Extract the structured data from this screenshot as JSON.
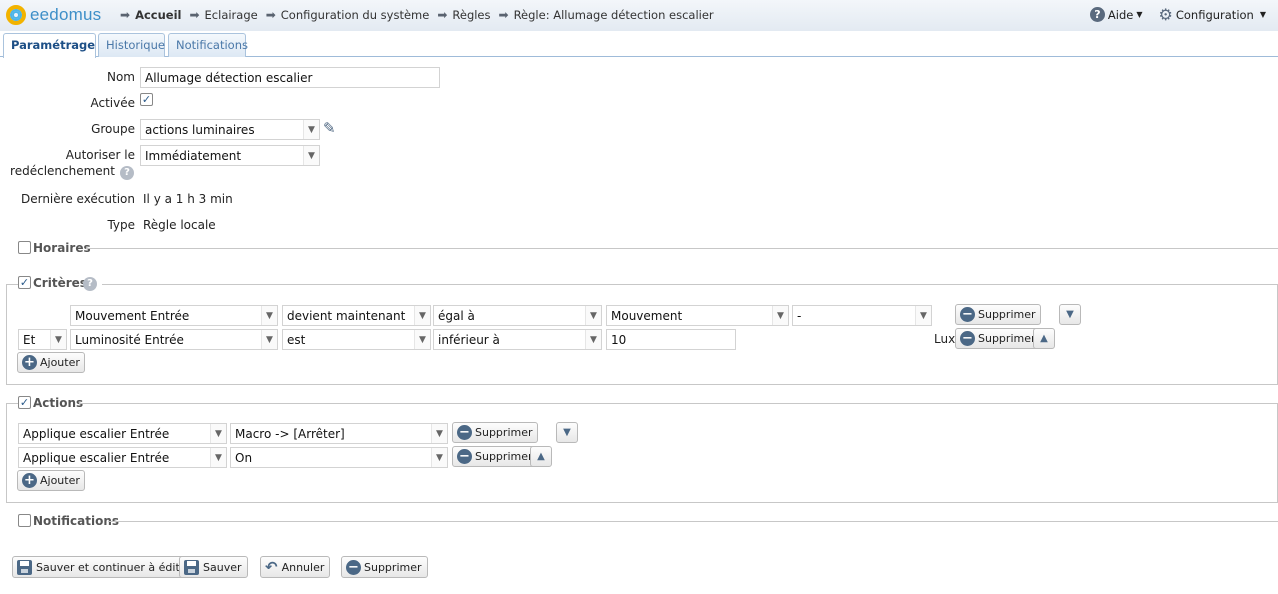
{
  "header": {
    "logo_text": "eedomus",
    "breadcrumb": [
      "Accueil",
      "Eclairage",
      "Configuration du système",
      "Règles",
      "Règle: Allumage détection escalier"
    ],
    "help_label": "Aide",
    "config_label": "Configuration"
  },
  "tabs": [
    "Paramétrage",
    "Historique",
    "Notifications"
  ],
  "form": {
    "name_label": "Nom",
    "name_value": "Allumage détection escalier",
    "active_label": "Activée",
    "active_checked": true,
    "group_label": "Groupe",
    "group_value": "actions luminaires",
    "retrigger_label_1": "Autoriser le",
    "retrigger_label_2": "redéclenchement",
    "retrigger_value": "Immédiatement",
    "last_exec_label": "Dernière exécution",
    "last_exec_value": "Il y a 1 h 3 min",
    "type_label": "Type",
    "type_value": "Règle locale"
  },
  "sections": {
    "schedules": {
      "title": "Horaires",
      "checked": false
    },
    "criteria": {
      "title": "Critères",
      "checked": true
    },
    "actions": {
      "title": "Actions",
      "checked": true
    },
    "notifications": {
      "title": "Notifications",
      "checked": false
    }
  },
  "criteria": [
    {
      "connector": "",
      "device": "Mouvement Entrée",
      "condition": "devient maintenant",
      "comparator": "égal à",
      "value": "Mouvement",
      "extra": "-",
      "unit": "",
      "delete_label": "Supprimer",
      "move": "down"
    },
    {
      "connector": "Et",
      "device": "Luminosité Entrée",
      "condition": "est",
      "comparator": "inférieur à",
      "value": "10",
      "extra": "",
      "unit": "Lux",
      "delete_label": "Supprimer",
      "move": "up"
    }
  ],
  "criteria_add_label": "Ajouter",
  "actions": [
    {
      "device": "Applique escalier Entrée",
      "action": "Macro -> [Arrêter]",
      "delete_label": "Supprimer",
      "move": "down"
    },
    {
      "device": "Applique escalier Entrée",
      "action": "On",
      "delete_label": "Supprimer",
      "move": "up"
    }
  ],
  "actions_add_label": "Ajouter",
  "footer": {
    "save_continue": "Sauver et continuer à éditer",
    "save": "Sauver",
    "cancel": "Annuler",
    "delete": "Supprimer"
  },
  "icons": {
    "arrow": "right-arrow-icon",
    "check": "✓",
    "dropdown": "▼",
    "arrow_down": "▼",
    "arrow_up": "▲",
    "question": "?",
    "minus": "−",
    "plus": "+",
    "pencil": "✎",
    "gear": "⚙",
    "undo": "↶"
  },
  "colors": {
    "brand_blue": "#3e8fc8",
    "brand_yellow": "#f2b300",
    "icon_blue": "#4b6886",
    "tab_active_text": "#1d4f86"
  }
}
